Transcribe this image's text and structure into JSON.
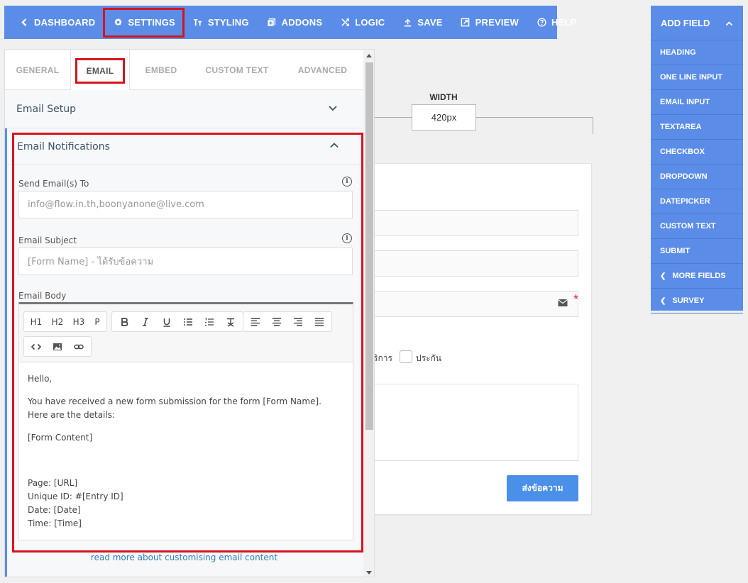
{
  "toolbar": {
    "items": [
      {
        "label": "DASHBOARD",
        "icon": "chevron-left-icon"
      },
      {
        "label": "SETTINGS",
        "icon": "gear-icon"
      },
      {
        "label": "STYLING",
        "icon": "text-style-icon"
      },
      {
        "label": "ADDONS",
        "icon": "addons-icon"
      },
      {
        "label": "LOGIC",
        "icon": "shuffle-icon"
      },
      {
        "label": "SAVE",
        "icon": "upload-icon"
      },
      {
        "label": "PREVIEW",
        "icon": "external-link-icon"
      },
      {
        "label": "HELP",
        "icon": "help-icon"
      }
    ],
    "active": "SETTINGS",
    "colors": {
      "background": "#5b8de8",
      "highlight": "#d7131e"
    }
  },
  "tabs": {
    "items": [
      "GENERAL",
      "EMAIL",
      "EMBED",
      "CUSTOM TEXT",
      "ADVANCED"
    ],
    "active": "EMAIL"
  },
  "email_setup": {
    "title": "Email Setup"
  },
  "notifications": {
    "title": "Email Notifications",
    "send_to_label": "Send Email(s) To",
    "send_to_placeholder": "info@flow.in.th,boonyanone@live.com",
    "subject_label": "Email Subject",
    "subject_placeholder": "[Form Name] - ได้รับข้อความ",
    "body_label": "Email Body",
    "info_glyph": "i"
  },
  "editor": {
    "heading_buttons": [
      "H1",
      "H2",
      "H3",
      "P"
    ],
    "format_buttons": [
      "bold-icon",
      "italic-icon",
      "underline-icon",
      "bullet-list-icon",
      "numbered-list-icon",
      "clear-format-icon"
    ],
    "align_buttons": [
      "align-left-icon",
      "align-center-icon",
      "align-right-icon",
      "align-justify-icon"
    ],
    "insert_buttons": [
      "code-icon",
      "image-icon",
      "link-icon"
    ],
    "content": {
      "greeting": "Hello,",
      "intro": "You have received a new form submission for the form [Form Name]. Here are the details:",
      "form_content": "[Form Content]",
      "page": "Page: [URL]",
      "unique_id": "Unique ID: #[Entry ID]",
      "date": "Date: [Date]",
      "time": "Time: [Time]"
    }
  },
  "read_more": "read more about customising email content",
  "canvas": {
    "width_label": "WIDTH",
    "width_value": "420px",
    "option_partial": "ริการ",
    "option_label": "ประกัน",
    "required_marker": "*",
    "submit_label": "ส่งข้อความ"
  },
  "add_field": {
    "title": "ADD FIELD",
    "items": [
      {
        "label": "HEADING"
      },
      {
        "label": "ONE LINE INPUT"
      },
      {
        "label": "EMAIL INPUT"
      },
      {
        "label": "TEXTAREA"
      },
      {
        "label": "CHECKBOX"
      },
      {
        "label": "DROPDOWN"
      },
      {
        "label": "DATEPICKER"
      },
      {
        "label": "CUSTOM TEXT"
      },
      {
        "label": "SUBMIT"
      },
      {
        "label": "MORE FIELDS",
        "chevron": true
      },
      {
        "label": "SURVEY",
        "chevron": true
      }
    ]
  }
}
